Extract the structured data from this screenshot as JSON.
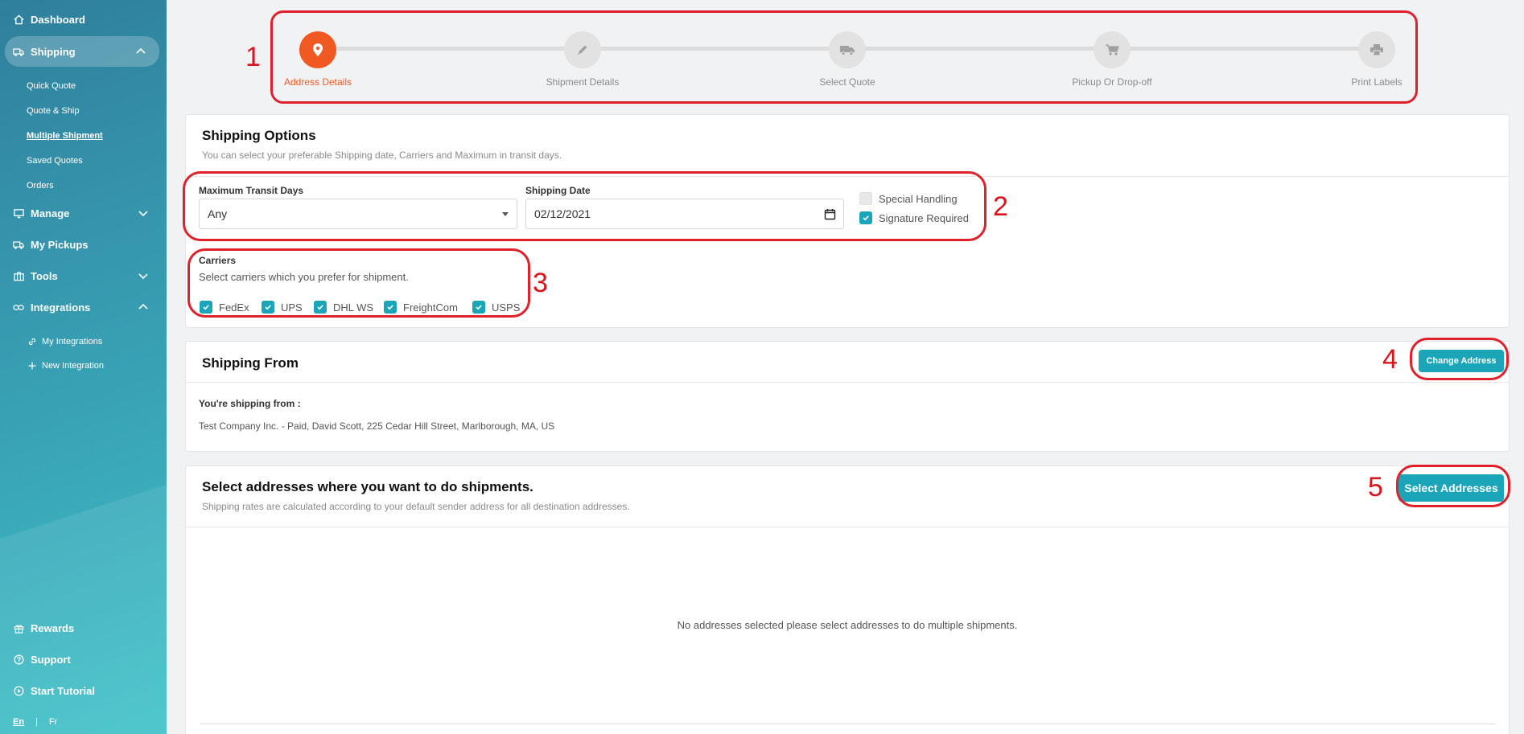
{
  "sidebar": {
    "dashboard": "Dashboard",
    "shipping": "Shipping",
    "shipping_sub": [
      "Quick Quote",
      "Quote & Ship",
      "Multiple Shipment",
      "Saved Quotes",
      "Orders"
    ],
    "manage": "Manage",
    "my_pickups": "My Pickups",
    "tools": "Tools",
    "integrations": "Integrations",
    "integrations_sub": [
      "My Integrations",
      "New Integration"
    ],
    "rewards": "Rewards",
    "support": "Support",
    "start_tutorial": "Start Tutorial",
    "lang_en": "En",
    "lang_sep": "|",
    "lang_fr": "Fr"
  },
  "stepper": {
    "steps": [
      {
        "label": "Address Details",
        "icon": "map-pin-icon",
        "active": true
      },
      {
        "label": "Shipment Details",
        "icon": "pencil-icon",
        "active": false
      },
      {
        "label": "Select Quote",
        "icon": "truck-icon",
        "active": false
      },
      {
        "label": "Pickup Or Drop-off",
        "icon": "cart-icon",
        "active": false
      },
      {
        "label": "Print Labels",
        "icon": "printer-icon",
        "active": false
      }
    ]
  },
  "annotations": [
    "1",
    "2",
    "3",
    "4",
    "5"
  ],
  "shipping_options": {
    "title": "Shipping Options",
    "subtitle": "You can select your preferable Shipping date, Carriers and Maximum in transit days.",
    "transit_label": "Maximum Transit Days",
    "transit_value": "Any",
    "date_label": "Shipping Date",
    "date_value": "02/12/2021",
    "special_handling": "Special Handling",
    "special_handling_checked": false,
    "signature_required": "Signature Required",
    "signature_required_checked": true,
    "carriers_label": "Carriers",
    "carriers_hint": "Select carriers which you prefer for shipment.",
    "carriers": [
      "FedEx",
      "UPS",
      "DHL WS",
      "FreightCom",
      "USPS"
    ]
  },
  "shipping_from": {
    "title": "Shipping From",
    "change_button": "Change Address",
    "from_label": "You're shipping from :",
    "address": "Test Company Inc. - Paid, David Scott, 225 Cedar Hill Street, Marlborough, MA, US"
  },
  "select_addresses": {
    "title": "Select addresses where you want to do shipments.",
    "subtitle": "Shipping rates are calculated according to your default sender address for all destination addresses.",
    "button": "Select Addresses",
    "empty": "No addresses selected please select addresses to do multiple shipments."
  },
  "colors": {
    "accent": "#1aa5b9",
    "active_step": "#f05a22",
    "annotation": "#e0202a"
  }
}
